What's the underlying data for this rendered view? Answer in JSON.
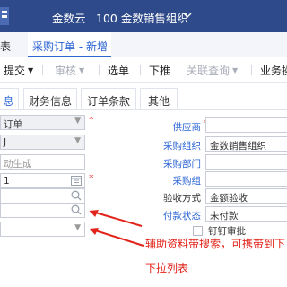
{
  "header": {
    "app_name": "金数云",
    "org_name": "100 金数销售组织",
    "accent_color": "#2f4a8a"
  },
  "tabs": {
    "prev_label": "表",
    "active_label": "采购订单 - 新增"
  },
  "toolbar": {
    "submit_label": "提交",
    "audit_label": "审核",
    "select_label": "选单",
    "push_label": "下推",
    "related_label": "关联查询",
    "business_label": "业务操"
  },
  "subtabs": {
    "basic_label": "息",
    "finance_label": "财务信息",
    "terms_label": "订单条款",
    "other_label": "其他"
  },
  "form_left": {
    "doc_type_value": "订单",
    "biz_type_value": "J",
    "doc_no_placeholder": "动生成",
    "date_value": "1"
  },
  "form_right": {
    "supplier_label": "供应商",
    "purchase_org_label": "采购组织",
    "purchase_org_value": "金数销售组织",
    "purchase_dept_label": "采购部门",
    "purchase_group_label": "采购组",
    "accept_method_label": "验收方式",
    "accept_method_value": "金额验收",
    "pay_status_label": "付款状态",
    "pay_status_value": "未付款",
    "pin_approval_label": "钉钉审批"
  },
  "annotations": {
    "aux_search_text": "辅助资料带搜索，可携带到下",
    "dropdown_text": "下拉列表",
    "color": "#e2231a"
  }
}
